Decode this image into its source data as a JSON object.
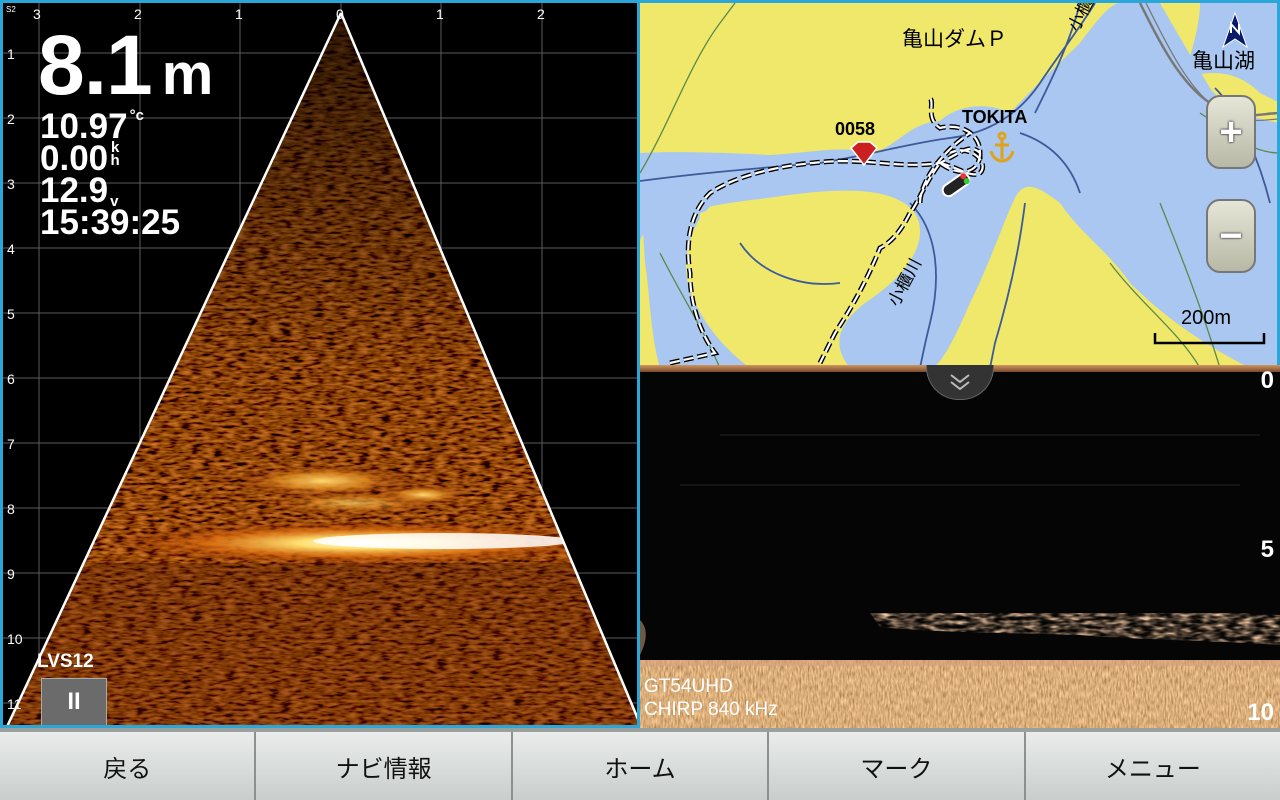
{
  "livescope": {
    "range_ticks": [
      "3",
      "2",
      "1",
      "0",
      "1",
      "2"
    ],
    "depth_ticks": [
      "1",
      "2",
      "3",
      "4",
      "5",
      "6",
      "7",
      "8",
      "9",
      "10",
      "11"
    ],
    "corner_label": "S2",
    "depth_value": "8.1",
    "depth_unit": "m",
    "water_temp_value": "10.97",
    "water_temp_unit": "°c",
    "speed_value": "0.00",
    "speed_unit_top": "k",
    "speed_unit_bottom": "h",
    "voltage_value": "12.9",
    "voltage_unit": "v",
    "time": "15:39:25",
    "transducer": "LVS12",
    "pause_label": "II",
    "colors": {
      "border": "#2aa7d8",
      "echo_hot": "#fff3a0",
      "echo_mid": "#d86a10",
      "echo_low": "#3a1206"
    }
  },
  "map": {
    "place_dam_park": "亀山ダムＰ",
    "place_lake": "亀山湖",
    "river_label_1": "小櫃川",
    "river_label_2": "小櫃川",
    "waypoint_name": "0058",
    "anchor_label": "TOKITA",
    "zoom_in_label": "+",
    "zoom_out_label": "−",
    "scale_label": "200m",
    "north_icon": "north-arrow-icon",
    "colors": {
      "land": "#efe86a",
      "water": "#a9c7f0",
      "contour": "#3d5a9a",
      "track": "#000000",
      "waypoint": "#cc1f1f"
    }
  },
  "sonar": {
    "depth_ticks": [
      "0",
      "5",
      "10"
    ],
    "transducer": "GT54UHD",
    "frequency": "CHIRP 840 kHz",
    "collapse_icon": "double-chevron-down-icon"
  },
  "menu": {
    "items": [
      "戻る",
      "ナビ情報",
      "ホーム",
      "マーク",
      "メニュー"
    ]
  }
}
